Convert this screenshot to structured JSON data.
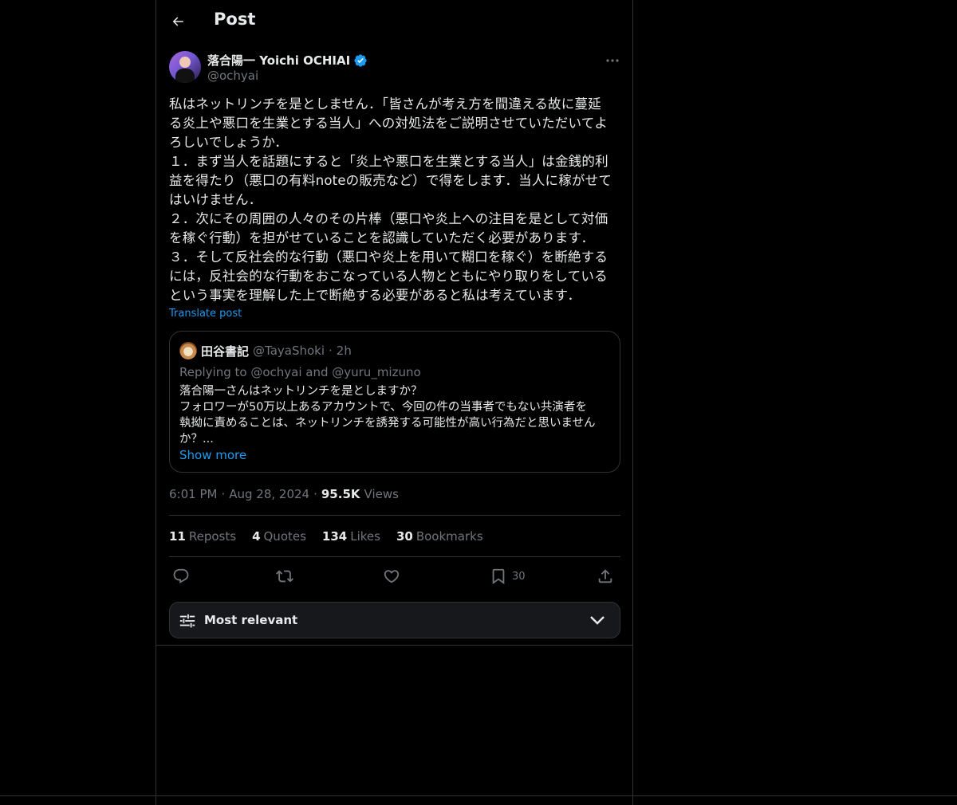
{
  "header": {
    "title": "Post"
  },
  "author": {
    "display_name": "落合陽一 Yoichi OCHIAI",
    "handle": "@ochyai",
    "verified": true
  },
  "post": {
    "text": "私はネットリンチを是としません．「皆さんが考え方を間違える故に蔓延\nる炎上や悪口を生業とする当人」への対処法をご説明させていただいてよ\nろしいでしょうか．\n１．まず当人を話題にすると「炎上や悪口を生業とする当人」は金銭的利\n益を得たり（悪口の有料noteの販売など）で得をします．当人に稼がせて\nはいけません．\n２．次にその周囲の人々のその片棒（悪口や炎上への注目を是として対価\nを稼ぐ行動）を担がせていることを認識していただく必要があります．\n３．そして反社会的な行動（悪口や炎上を用いて糊口を稼ぐ）を断絶する\nには，反社会的な行動をおこなっている人物とともにやり取りをしている\nという事実を理解した上で断絶する必要があると私は考えています．",
    "translate_label": "Translate post",
    "time": "6:01 PM",
    "date": "Aug 28, 2024",
    "views_count": "95.5K",
    "views_label": "Views"
  },
  "quote": {
    "name": "田谷書記",
    "handle": "@TayaShoki",
    "time": "2h",
    "replying": "Replying to @ochyai and @yuru_mizuno",
    "text": "落合陽一さんはネットリンチを是としますか？\nフォロワーが50万以上あるアカウントで、今回の件の当事者でもない共演者を\n執拗に責めることは、ネットリンチを誘発する可能性が高い行為だと思いません\nか？...",
    "show_more": "Show more"
  },
  "stats": {
    "reposts_count": "11",
    "reposts_label": "Reposts",
    "quotes_count": "4",
    "quotes_label": "Quotes",
    "likes_count": "134",
    "likes_label": "Likes",
    "bookmarks_count": "30",
    "bookmarks_label": "Bookmarks"
  },
  "actions": {
    "bookmark_count": "30"
  },
  "sort": {
    "label": "Most relevant"
  },
  "colors": {
    "accent": "#1d9bf0",
    "muted": "#71767b",
    "text": "#e7e9ea",
    "border": "#2f3336",
    "background": "#000000"
  }
}
